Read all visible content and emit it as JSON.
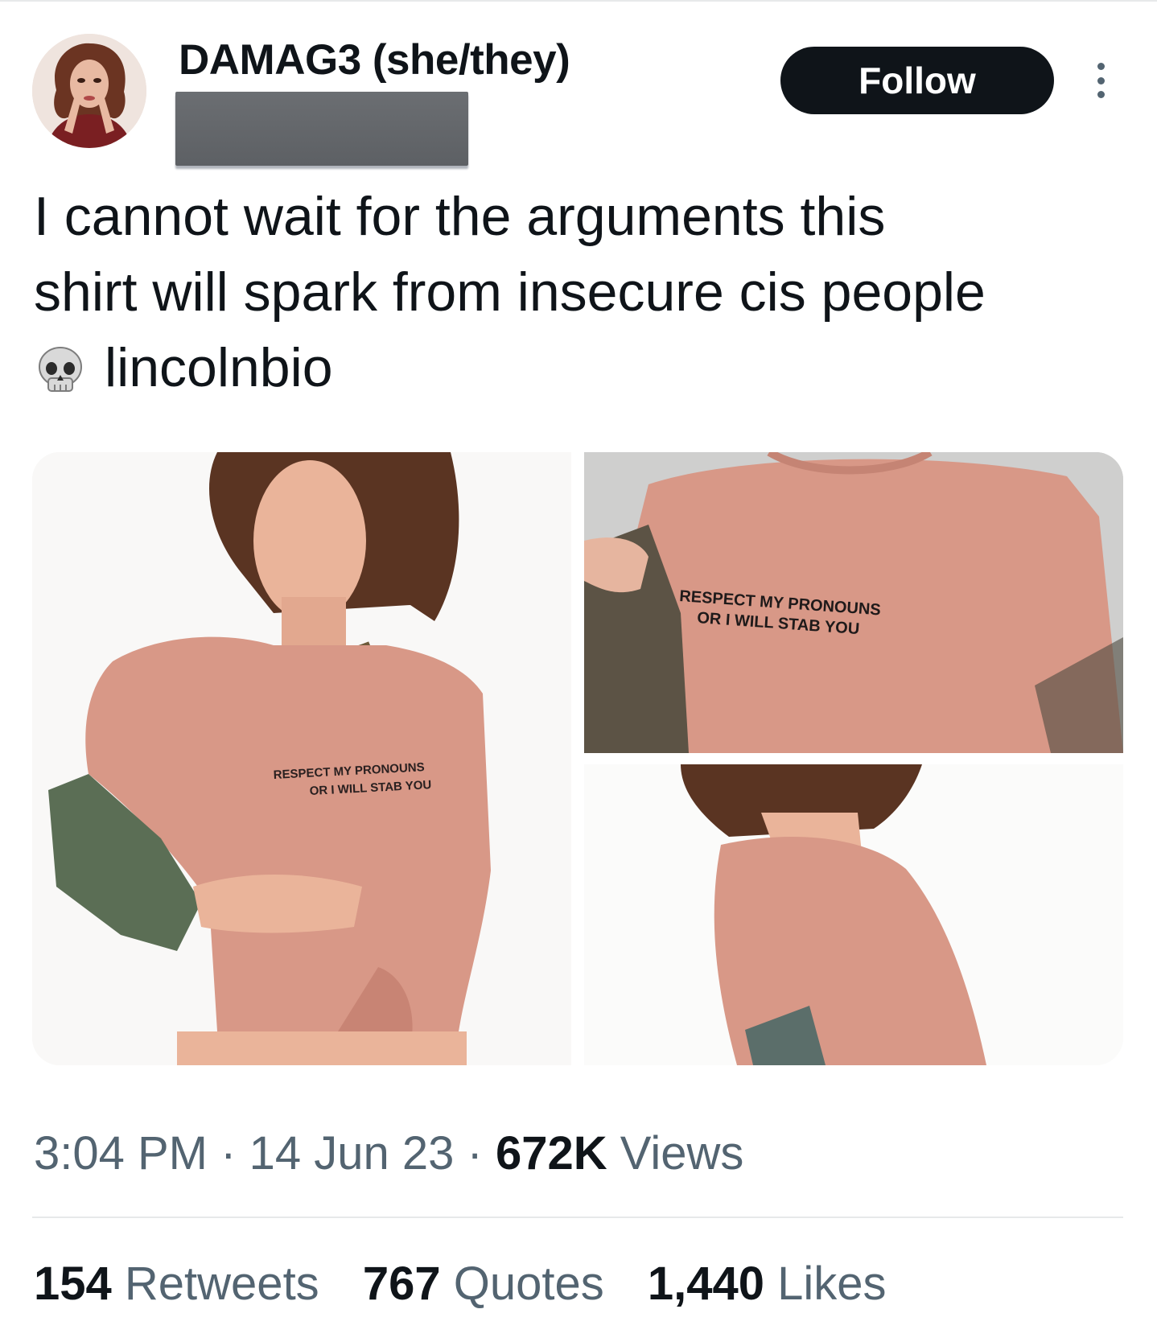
{
  "author": {
    "display_name": "DAMAG3 (she/they)",
    "handle": ""
  },
  "actions": {
    "follow_label": "Follow"
  },
  "tweet": {
    "line1": "I cannot wait for the arguments this",
    "line2": "shirt will spark from insecure cis people",
    "line3": "lincolnbio"
  },
  "media": {
    "photo_count": 3,
    "shirt_text_line1": "RESPECT MY PRONOUNS",
    "shirt_text_line2": "OR I WILL STAB YOU"
  },
  "meta": {
    "time": "3:04 PM",
    "separator": "·",
    "date": "14 Jun 23",
    "views_count": "672K",
    "views_label": "Views"
  },
  "stats": {
    "retweets_count": "154",
    "retweets_label": "Retweets",
    "quotes_count": "767",
    "quotes_label": "Quotes",
    "likes_count": "1,440",
    "likes_label": "Likes"
  },
  "colors": {
    "text_primary": "#0f1419",
    "text_secondary": "#536471",
    "divider": "#e7e9ea",
    "shirt_pink": "#d89887"
  },
  "icons": [
    "avatar",
    "more-icon",
    "skull-emoji-icon"
  ]
}
